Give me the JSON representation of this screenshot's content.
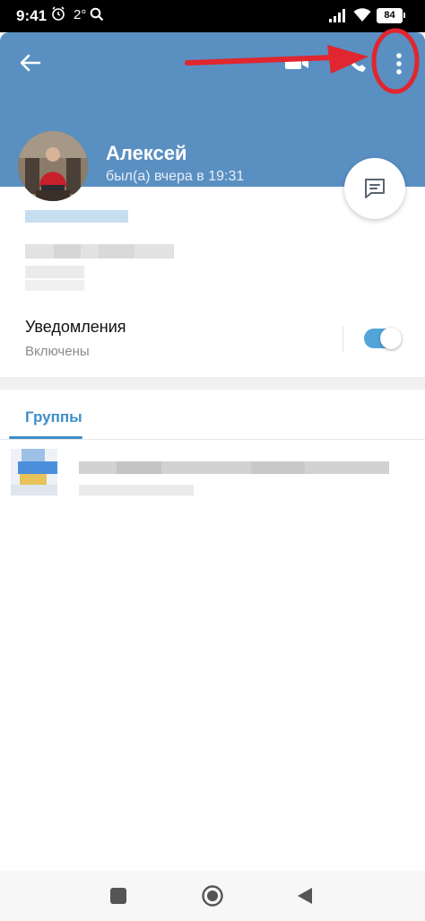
{
  "status_bar": {
    "time": "9:41",
    "temperature": "2°",
    "battery": "84"
  },
  "header": {
    "name": "Алексей",
    "last_seen": "был(а) вчера в 19:31",
    "background_color": "#5a8fc2"
  },
  "notifications": {
    "title": "Уведомления",
    "status": "Включены",
    "enabled": true
  },
  "tabs": {
    "groups_label": "Группы"
  },
  "icons": {
    "back": "arrow-left-icon",
    "video": "video-call-icon",
    "call": "phone-icon",
    "more": "more-vert-icon",
    "message": "message-icon"
  },
  "colors": {
    "accent": "#3e8ec9",
    "annotation": "#e0262f"
  }
}
